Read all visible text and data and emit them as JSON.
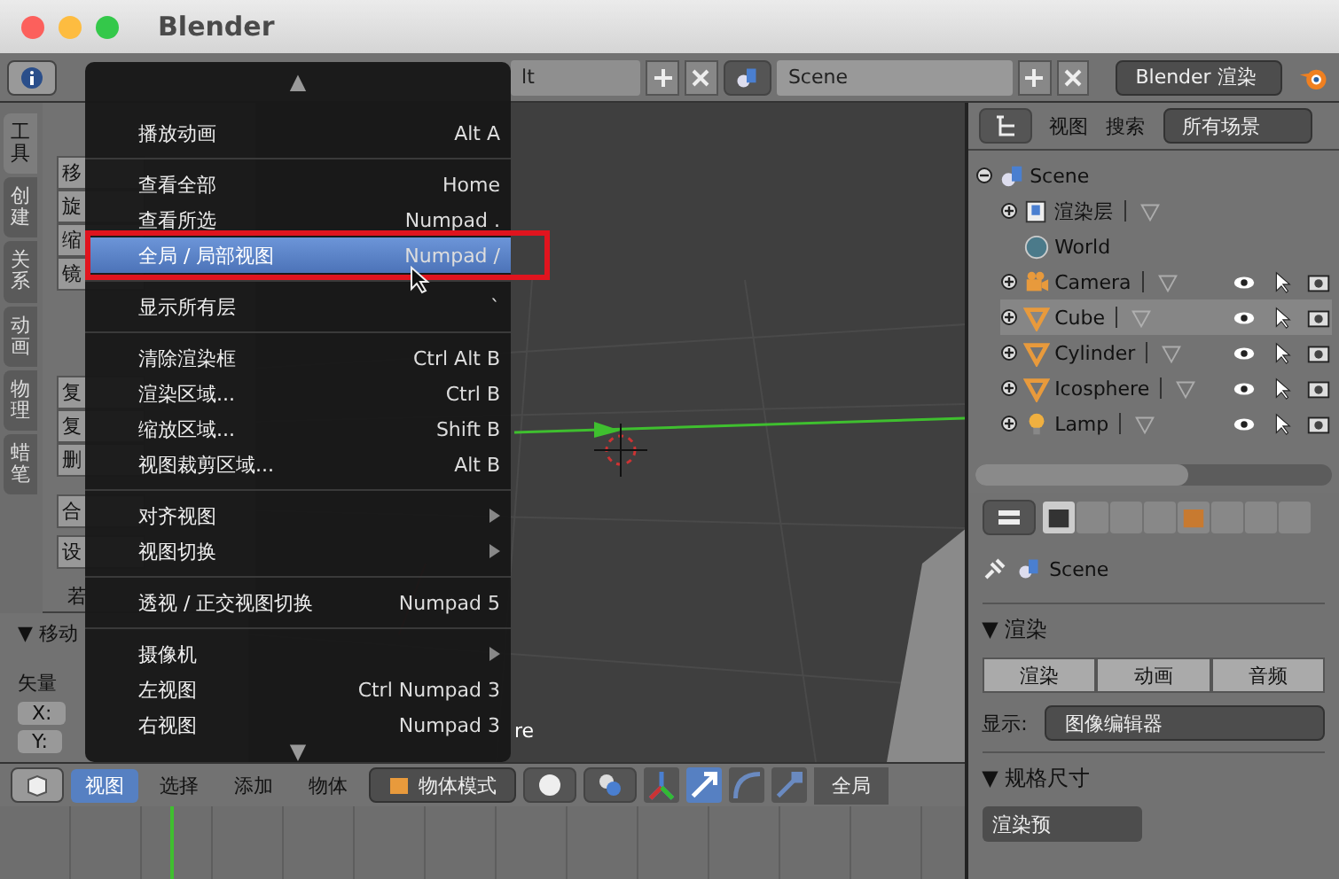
{
  "window": {
    "title": "Blender"
  },
  "top_header": {
    "layout_field": "lt",
    "scene_field": "Scene",
    "render_engine": "Blender 渲染"
  },
  "tool_shelf": {
    "tabs": [
      {
        "label": "工具",
        "selected": true
      },
      {
        "label": "创建",
        "selected": false
      },
      {
        "label": "关系",
        "selected": false
      },
      {
        "label": "动画",
        "selected": false
      },
      {
        "label": "物理",
        "selected": false
      },
      {
        "label": "蜡笔",
        "selected": false
      }
    ],
    "buttons": [
      "移",
      "旋",
      "缩",
      "镜",
      "复",
      "复",
      "删",
      "合",
      "设"
    ],
    "label": "若",
    "operator_panel": "▼ 移动",
    "vector_label": "矢量",
    "fields": [
      "X:",
      "Y:"
    ]
  },
  "viewport": {
    "object_label": "re"
  },
  "view_menu": {
    "scroll_up": "▲",
    "scroll_down": "▼",
    "items": [
      {
        "kind": "item",
        "label": "播放动画",
        "shortcut": "Alt A",
        "selected": false
      },
      {
        "kind": "separator"
      },
      {
        "kind": "item",
        "label": "查看全部",
        "shortcut": "Home",
        "selected": false
      },
      {
        "kind": "item",
        "label": "查看所选",
        "shortcut": "Numpad .",
        "selected": false
      },
      {
        "kind": "item",
        "label": "全局 / 局部视图",
        "shortcut": "Numpad /",
        "selected": true
      },
      {
        "kind": "separator"
      },
      {
        "kind": "item",
        "label": "显示所有层",
        "shortcut": "`",
        "selected": false
      },
      {
        "kind": "separator"
      },
      {
        "kind": "item",
        "label": "清除渲染框",
        "shortcut": "Ctrl Alt B",
        "selected": false
      },
      {
        "kind": "item",
        "label": "渲染区域...",
        "shortcut": "Ctrl B",
        "selected": false
      },
      {
        "kind": "item",
        "label": "缩放区域...",
        "shortcut": "Shift B",
        "selected": false
      },
      {
        "kind": "item",
        "label": "视图裁剪区域...",
        "shortcut": "Alt B",
        "selected": false
      },
      {
        "kind": "separator"
      },
      {
        "kind": "submenu",
        "label": "对齐视图",
        "selected": false
      },
      {
        "kind": "submenu",
        "label": "视图切换",
        "selected": false
      },
      {
        "kind": "separator"
      },
      {
        "kind": "item",
        "label": "透视 / 正交视图切换",
        "shortcut": "Numpad 5",
        "selected": false
      },
      {
        "kind": "separator"
      },
      {
        "kind": "submenu",
        "label": "摄像机",
        "selected": false
      },
      {
        "kind": "item",
        "label": "左视图",
        "shortcut": "Ctrl Numpad 3",
        "selected": false
      },
      {
        "kind": "item",
        "label": "右视图",
        "shortcut": "Numpad 3",
        "selected": false
      }
    ]
  },
  "outliner": {
    "header": {
      "view": "视图",
      "search": "搜索",
      "filter": "所有场景"
    },
    "tree": [
      {
        "kind": "scene",
        "label": "Scene",
        "selected": false,
        "children": [
          {
            "kind": "layer",
            "label": "渲染层",
            "selected": false
          },
          {
            "kind": "world",
            "label": "World",
            "selected": false
          },
          {
            "kind": "camera",
            "label": "Camera",
            "selected": false
          },
          {
            "kind": "mesh",
            "label": "Cube",
            "selected": true
          },
          {
            "kind": "mesh",
            "label": "Cylinder",
            "selected": false
          },
          {
            "kind": "mesh",
            "label": "Icosphere",
            "selected": false
          },
          {
            "kind": "lamp",
            "label": "Lamp",
            "selected": false
          }
        ]
      }
    ]
  },
  "properties": {
    "context": "Scene",
    "render_panel": {
      "title": "▼ 渲染",
      "buttons": [
        "渲染",
        "动画",
        "音频"
      ],
      "display_label": "显示:",
      "display_value": "图像编辑器"
    },
    "dimensions_panel": {
      "title": "▼ 规格尺寸",
      "preset": "渲染预"
    }
  },
  "bottom_header": {
    "menus": [
      {
        "label": "视图",
        "selected": true
      },
      {
        "label": "选择",
        "selected": false
      },
      {
        "label": "添加",
        "selected": false
      },
      {
        "label": "物体",
        "selected": false
      }
    ],
    "mode": "物体模式",
    "orientation": "全局"
  }
}
